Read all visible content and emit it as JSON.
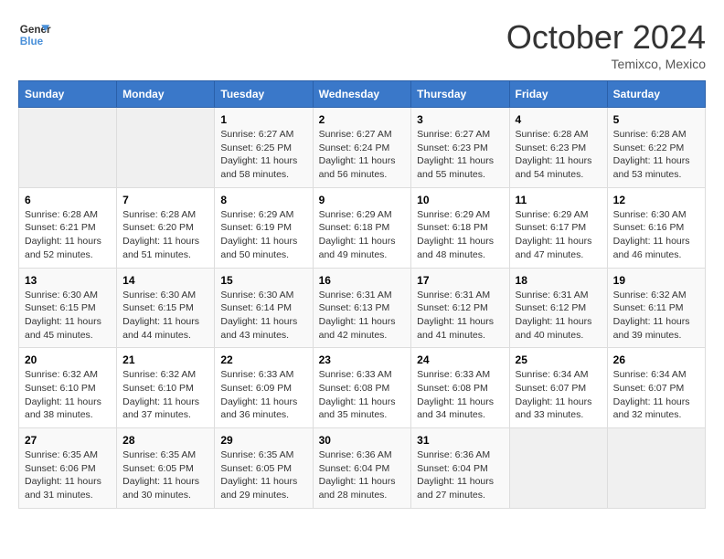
{
  "logo": {
    "line1": "General",
    "line2": "Blue"
  },
  "title": "October 2024",
  "subtitle": "Temixco, Mexico",
  "days_of_week": [
    "Sunday",
    "Monday",
    "Tuesday",
    "Wednesday",
    "Thursday",
    "Friday",
    "Saturday"
  ],
  "weeks": [
    [
      {
        "day": "",
        "info": ""
      },
      {
        "day": "",
        "info": ""
      },
      {
        "day": "1",
        "info": "Sunrise: 6:27 AM\nSunset: 6:25 PM\nDaylight: 11 hours and 58 minutes."
      },
      {
        "day": "2",
        "info": "Sunrise: 6:27 AM\nSunset: 6:24 PM\nDaylight: 11 hours and 56 minutes."
      },
      {
        "day": "3",
        "info": "Sunrise: 6:27 AM\nSunset: 6:23 PM\nDaylight: 11 hours and 55 minutes."
      },
      {
        "day": "4",
        "info": "Sunrise: 6:28 AM\nSunset: 6:23 PM\nDaylight: 11 hours and 54 minutes."
      },
      {
        "day": "5",
        "info": "Sunrise: 6:28 AM\nSunset: 6:22 PM\nDaylight: 11 hours and 53 minutes."
      }
    ],
    [
      {
        "day": "6",
        "info": "Sunrise: 6:28 AM\nSunset: 6:21 PM\nDaylight: 11 hours and 52 minutes."
      },
      {
        "day": "7",
        "info": "Sunrise: 6:28 AM\nSunset: 6:20 PM\nDaylight: 11 hours and 51 minutes."
      },
      {
        "day": "8",
        "info": "Sunrise: 6:29 AM\nSunset: 6:19 PM\nDaylight: 11 hours and 50 minutes."
      },
      {
        "day": "9",
        "info": "Sunrise: 6:29 AM\nSunset: 6:18 PM\nDaylight: 11 hours and 49 minutes."
      },
      {
        "day": "10",
        "info": "Sunrise: 6:29 AM\nSunset: 6:18 PM\nDaylight: 11 hours and 48 minutes."
      },
      {
        "day": "11",
        "info": "Sunrise: 6:29 AM\nSunset: 6:17 PM\nDaylight: 11 hours and 47 minutes."
      },
      {
        "day": "12",
        "info": "Sunrise: 6:30 AM\nSunset: 6:16 PM\nDaylight: 11 hours and 46 minutes."
      }
    ],
    [
      {
        "day": "13",
        "info": "Sunrise: 6:30 AM\nSunset: 6:15 PM\nDaylight: 11 hours and 45 minutes."
      },
      {
        "day": "14",
        "info": "Sunrise: 6:30 AM\nSunset: 6:15 PM\nDaylight: 11 hours and 44 minutes."
      },
      {
        "day": "15",
        "info": "Sunrise: 6:30 AM\nSunset: 6:14 PM\nDaylight: 11 hours and 43 minutes."
      },
      {
        "day": "16",
        "info": "Sunrise: 6:31 AM\nSunset: 6:13 PM\nDaylight: 11 hours and 42 minutes."
      },
      {
        "day": "17",
        "info": "Sunrise: 6:31 AM\nSunset: 6:12 PM\nDaylight: 11 hours and 41 minutes."
      },
      {
        "day": "18",
        "info": "Sunrise: 6:31 AM\nSunset: 6:12 PM\nDaylight: 11 hours and 40 minutes."
      },
      {
        "day": "19",
        "info": "Sunrise: 6:32 AM\nSunset: 6:11 PM\nDaylight: 11 hours and 39 minutes."
      }
    ],
    [
      {
        "day": "20",
        "info": "Sunrise: 6:32 AM\nSunset: 6:10 PM\nDaylight: 11 hours and 38 minutes."
      },
      {
        "day": "21",
        "info": "Sunrise: 6:32 AM\nSunset: 6:10 PM\nDaylight: 11 hours and 37 minutes."
      },
      {
        "day": "22",
        "info": "Sunrise: 6:33 AM\nSunset: 6:09 PM\nDaylight: 11 hours and 36 minutes."
      },
      {
        "day": "23",
        "info": "Sunrise: 6:33 AM\nSunset: 6:08 PM\nDaylight: 11 hours and 35 minutes."
      },
      {
        "day": "24",
        "info": "Sunrise: 6:33 AM\nSunset: 6:08 PM\nDaylight: 11 hours and 34 minutes."
      },
      {
        "day": "25",
        "info": "Sunrise: 6:34 AM\nSunset: 6:07 PM\nDaylight: 11 hours and 33 minutes."
      },
      {
        "day": "26",
        "info": "Sunrise: 6:34 AM\nSunset: 6:07 PM\nDaylight: 11 hours and 32 minutes."
      }
    ],
    [
      {
        "day": "27",
        "info": "Sunrise: 6:35 AM\nSunset: 6:06 PM\nDaylight: 11 hours and 31 minutes."
      },
      {
        "day": "28",
        "info": "Sunrise: 6:35 AM\nSunset: 6:05 PM\nDaylight: 11 hours and 30 minutes."
      },
      {
        "day": "29",
        "info": "Sunrise: 6:35 AM\nSunset: 6:05 PM\nDaylight: 11 hours and 29 minutes."
      },
      {
        "day": "30",
        "info": "Sunrise: 6:36 AM\nSunset: 6:04 PM\nDaylight: 11 hours and 28 minutes."
      },
      {
        "day": "31",
        "info": "Sunrise: 6:36 AM\nSunset: 6:04 PM\nDaylight: 11 hours and 27 minutes."
      },
      {
        "day": "",
        "info": ""
      },
      {
        "day": "",
        "info": ""
      }
    ]
  ],
  "accent_color": "#3a78c9"
}
